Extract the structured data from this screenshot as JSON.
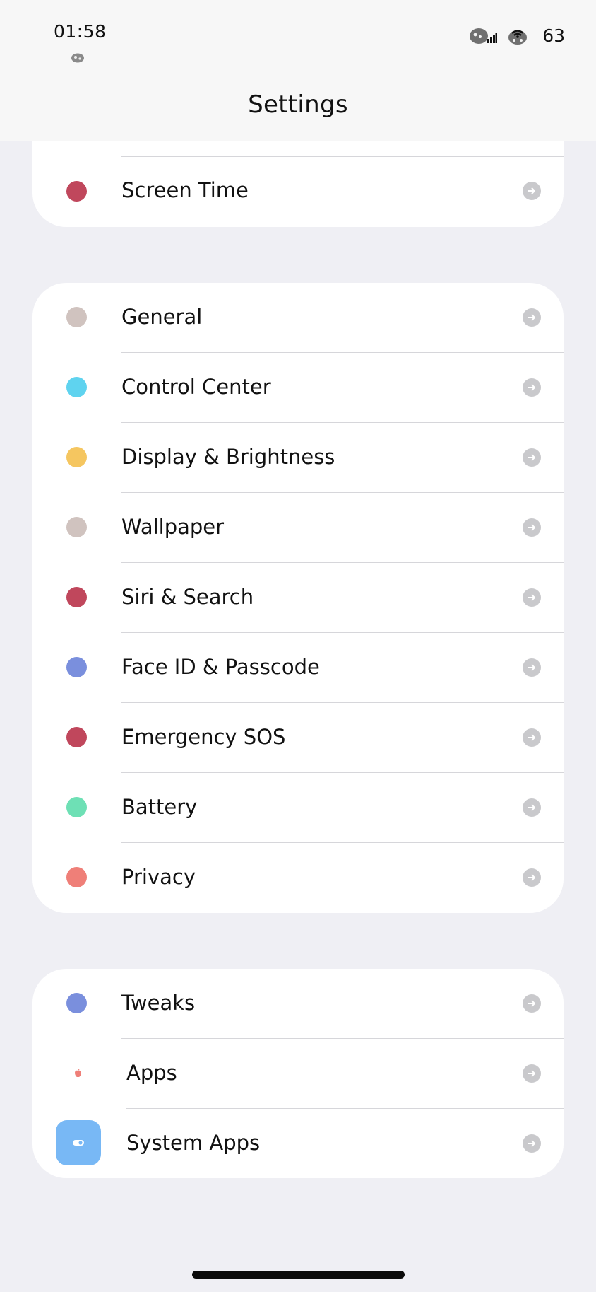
{
  "status": {
    "time": "01:58",
    "battery": "63"
  },
  "nav": {
    "title": "Settings"
  },
  "groups": [
    {
      "rows": [
        {
          "label": "Screen Time",
          "color": "#c0475c"
        }
      ]
    },
    {
      "rows": [
        {
          "label": "General",
          "color": "#d0c3bf"
        },
        {
          "label": "Control Center",
          "color": "#5fd3ef"
        },
        {
          "label": "Display & Brightness",
          "color": "#f5c660"
        },
        {
          "label": "Wallpaper",
          "color": "#d0c3bf"
        },
        {
          "label": "Siri & Search",
          "color": "#c0475c"
        },
        {
          "label": "Face ID & Passcode",
          "color": "#7a8fdd"
        },
        {
          "label": "Emergency SOS",
          "color": "#c0475c"
        },
        {
          "label": "Battery",
          "color": "#6ee0b5"
        },
        {
          "label": "Privacy",
          "color": "#ef7f78"
        }
      ]
    },
    {
      "rows": [
        {
          "label": "Tweaks",
          "color": "#7a8fdd",
          "icon": "dot"
        },
        {
          "label": "Apps",
          "color": "#ef7f78",
          "icon": "apple-icon"
        },
        {
          "label": "System Apps",
          "color": "#78b8f5",
          "icon": "toggle-app-icon"
        }
      ]
    }
  ]
}
